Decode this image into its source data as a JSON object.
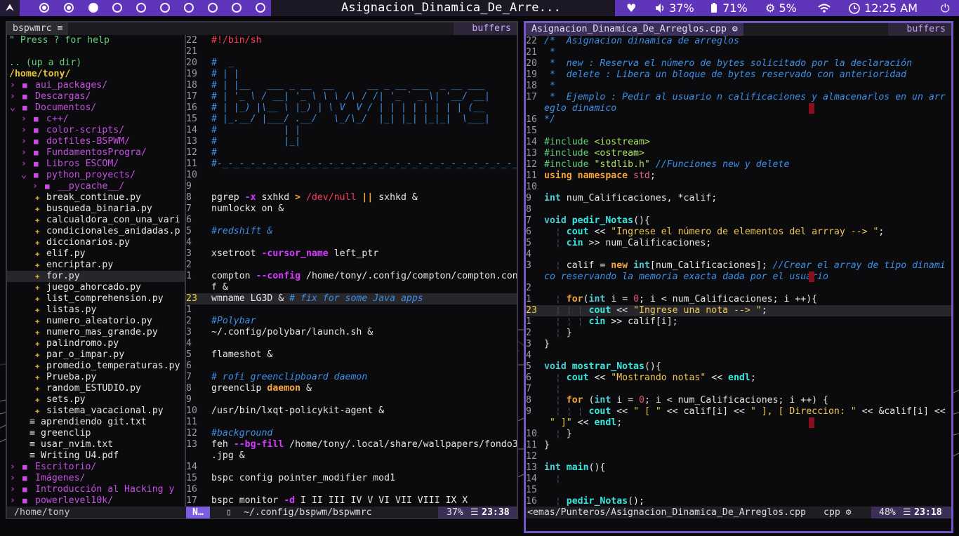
{
  "topbar": {
    "logo": "⮝",
    "window_title": "Asignacion_Dinamica_De_Arre...",
    "heart": "♥",
    "volume": "37%",
    "battery": "71%",
    "cpu": "5%",
    "clock": "12:25 AM",
    "power": "⏻"
  },
  "left": {
    "tab_title": "bspwmrc ≡",
    "buffers": "buffers",
    "status_path": "/home/tony",
    "status_mode": "N…",
    "status_file": "~/.config/bspwm/bspwmrc",
    "status_percent": "37%",
    "status_pos": "23:38"
  },
  "tree": [
    {
      "t": "\" Press ? for help",
      "c": "c-grn",
      "i": 0
    },
    {
      "t": "",
      "i": 0
    },
    {
      "t": ".. (up a dir)",
      "c": "c-grn",
      "i": 0
    },
    {
      "t": "/home/tony/",
      "c": "c-yel",
      "i": 0,
      "b": true
    },
    {
      "t": "aui_packages/",
      "k": "d",
      "o": false,
      "i": 0
    },
    {
      "t": "Descargas/",
      "k": "d",
      "o": false,
      "i": 0
    },
    {
      "t": "Documentos/",
      "k": "d",
      "o": true,
      "i": 0
    },
    {
      "t": "c++/",
      "k": "d",
      "o": false,
      "i": 1
    },
    {
      "t": "color-scripts/",
      "k": "d",
      "o": false,
      "i": 1
    },
    {
      "t": "dotfiles-BSPWM/",
      "k": "d",
      "o": false,
      "i": 1
    },
    {
      "t": "FundamentosProgra/",
      "k": "d",
      "o": false,
      "i": 1
    },
    {
      "t": "Libros ESCOM/",
      "k": "d",
      "o": false,
      "i": 1
    },
    {
      "t": "python_proyects/",
      "k": "d",
      "o": true,
      "i": 1
    },
    {
      "t": "__pycache__/",
      "k": "d",
      "o": false,
      "i": 2
    },
    {
      "t": "break_continue.py",
      "k": "p",
      "i": 2
    },
    {
      "t": "busqueda_binaria.py",
      "k": "p",
      "i": 2
    },
    {
      "t": "calcualdora_con_una_vari",
      "k": "p",
      "i": 2
    },
    {
      "t": "condicionales_anidadas.p",
      "k": "p",
      "i": 2
    },
    {
      "t": "diccionarios.py",
      "k": "p",
      "i": 2
    },
    {
      "t": "elif.py",
      "k": "p",
      "i": 2
    },
    {
      "t": "encriptar.py",
      "k": "p",
      "i": 2
    },
    {
      "t": "for.py",
      "k": "p",
      "i": 2,
      "sel": true
    },
    {
      "t": "juego_ahorcado.py",
      "k": "p",
      "i": 2
    },
    {
      "t": "list_comprehension.py",
      "k": "p",
      "i": 2
    },
    {
      "t": "listas.py",
      "k": "p",
      "i": 2
    },
    {
      "t": "numero_aleatorio.py",
      "k": "p",
      "i": 2
    },
    {
      "t": "numero_mas_grande.py",
      "k": "p",
      "i": 2
    },
    {
      "t": "palindromo.py",
      "k": "p",
      "i": 2
    },
    {
      "t": "par_o_impar.py",
      "k": "p",
      "i": 2
    },
    {
      "t": "promedio_temperaturas.py",
      "k": "p",
      "i": 2
    },
    {
      "t": "Prueba.py",
      "k": "p",
      "i": 2
    },
    {
      "t": "random_ESTUDIO.py",
      "k": "p",
      "i": 2
    },
    {
      "t": "sets.py",
      "k": "p",
      "i": 2
    },
    {
      "t": "sistema_vacacional.py",
      "k": "p",
      "i": 2
    },
    {
      "t": "aprendiendo git.txt",
      "k": "t",
      "i": 1
    },
    {
      "t": "greenclip",
      "k": "t",
      "i": 1
    },
    {
      "t": "usar_nvim.txt",
      "k": "t",
      "i": 1
    },
    {
      "t": "Writing U4.pdf",
      "k": "t",
      "i": 1
    },
    {
      "t": "Escritorio/",
      "k": "d",
      "o": false,
      "i": 0
    },
    {
      "t": "Imágenes/",
      "k": "d",
      "o": false,
      "i": 0
    },
    {
      "t": "Introducción al Hacking y",
      "k": "d",
      "o": false,
      "i": 0
    },
    {
      "t": "powerlevel10k/",
      "k": "d",
      "o": false,
      "i": 0
    }
  ],
  "bspwm_lines": [
    {
      "n": "22",
      "h": [
        [
          "c-red",
          "#!/bin/sh"
        ]
      ]
    },
    {
      "n": "21",
      "h": []
    },
    {
      "n": "20",
      "h": [
        [
          "c-cmt",
          "#  _"
        ]
      ]
    },
    {
      "n": "19",
      "h": [
        [
          "c-cmt",
          "# | |"
        ]
      ]
    },
    {
      "n": "18",
      "h": [
        [
          "c-cmt",
          "# | |__   ___ _ __  __      __ _ __ ___  _ __ ___"
        ]
      ]
    },
    {
      "n": "17",
      "h": [
        [
          "c-cmt",
          "# | '_ \\ / __| '_ \\ \\ \\ /\\ / /| '_ ` _ \\| '__/ __|"
        ]
      ]
    },
    {
      "n": "16",
      "h": [
        [
          "c-cmt",
          "# | |_) |\\__ \\ |_) | \\ V  V / | | | | | | | | (__"
        ]
      ]
    },
    {
      "n": "15",
      "h": [
        [
          "c-cmt",
          "# |_.__/ |___/ .__/   \\_/\\_/  |_| |_| |_|_|  \\___|"
        ]
      ]
    },
    {
      "n": "14",
      "h": [
        [
          "c-cmt",
          "#            | |"
        ]
      ]
    },
    {
      "n": "13",
      "h": [
        [
          "c-cmt",
          "#            |_|"
        ]
      ]
    },
    {
      "n": "12",
      "h": [
        [
          "c-cmt",
          "#"
        ]
      ]
    },
    {
      "n": "11",
      "h": [
        [
          "c-cmt",
          "#-_-_-_-_-_-_-_-_-_-_-_-_-_-_-_-_-_-_-_-_-_-_-_-_-_-_-_-_"
        ]
      ]
    },
    {
      "n": "10",
      "h": []
    },
    {
      "n": "9",
      "h": []
    },
    {
      "n": "8",
      "h": [
        [
          "",
          "pgrep "
        ],
        [
          "c-opt",
          "-x"
        ],
        [
          "",
          " sxhkd "
        ],
        [
          "c-kw",
          ">"
        ],
        [
          "c-red",
          " /dev/null "
        ],
        [
          "c-kw",
          "||"
        ],
        [
          "",
          " sxhkd &"
        ]
      ]
    },
    {
      "n": "7",
      "h": [
        [
          "",
          "numlockx on &"
        ]
      ]
    },
    {
      "n": "6",
      "h": []
    },
    {
      "n": "5",
      "h": [
        [
          "c-cmt",
          "#redshift &"
        ]
      ]
    },
    {
      "n": "4",
      "h": []
    },
    {
      "n": "3",
      "h": [
        [
          "",
          "xsetroot "
        ],
        [
          "c-opt",
          "-cursor_name"
        ],
        [
          "",
          " left_ptr"
        ]
      ]
    },
    {
      "n": "2",
      "h": []
    },
    {
      "n": "1",
      "h": [
        [
          "",
          "compton "
        ],
        [
          "c-opt",
          "--config"
        ],
        [
          "",
          " /home/tony/.config/compton/compton.con"
        ]
      ]
    },
    {
      "n": "",
      "h": [
        [
          "",
          "f &"
        ]
      ]
    },
    {
      "n": "23",
      "cur": true,
      "h": [
        [
          "",
          "wmname LG3D & "
        ],
        [
          "c-cmt",
          "# fix for some Java apps"
        ]
      ]
    },
    {
      "n": "1",
      "h": []
    },
    {
      "n": "2",
      "h": [
        [
          "c-cmt",
          "#Polybar"
        ]
      ]
    },
    {
      "n": "3",
      "h": [
        [
          "",
          "~/.config/polybar/launch.sh &"
        ]
      ]
    },
    {
      "n": "4",
      "h": []
    },
    {
      "n": "5",
      "h": [
        [
          "",
          "flameshot &"
        ]
      ]
    },
    {
      "n": "6",
      "h": []
    },
    {
      "n": "7",
      "h": [
        [
          "c-cmt",
          "# rofi greenclipboard daemon"
        ]
      ]
    },
    {
      "n": "8",
      "h": [
        [
          "",
          "greenclip "
        ],
        [
          "c-kw",
          "daemon"
        ],
        [
          "",
          " &"
        ]
      ]
    },
    {
      "n": "9",
      "h": []
    },
    {
      "n": "10",
      "h": [
        [
          "",
          "/usr/bin/lxqt-policykit-agent &"
        ]
      ]
    },
    {
      "n": "11",
      "h": []
    },
    {
      "n": "12",
      "h": [
        [
          "c-cmt",
          "#background"
        ]
      ]
    },
    {
      "n": "13",
      "h": [
        [
          "",
          "feh "
        ],
        [
          "c-opt",
          "--bg-fill"
        ],
        [
          "",
          " /home/tony/.local/share/wallpapers/fondo3"
        ]
      ]
    },
    {
      "n": "",
      "h": [
        [
          "",
          ".jpg &"
        ]
      ]
    },
    {
      "n": "14",
      "h": []
    },
    {
      "n": "15",
      "h": [
        [
          "",
          "bspc config pointer_modifier mod1"
        ]
      ]
    },
    {
      "n": "16",
      "h": []
    },
    {
      "n": "17",
      "h": [
        [
          "",
          "bspc monitor "
        ],
        [
          "c-opt",
          "-d"
        ],
        [
          "",
          " I II III IV V VI VII VIII IX X"
        ]
      ]
    }
  ],
  "right": {
    "tab_title": "Asignacion_Dinamica_De_Arreglos.cpp ⚙",
    "buffers": "buffers",
    "status_file": "<emas/Punteros/Asignacion_Dinamica_De_Arreglos.cpp",
    "status_ft": "cpp ⚙",
    "status_percent": "48%",
    "status_pos": "23:18"
  },
  "cpp_lines": [
    {
      "n": "22",
      "h": [
        [
          "c-cmt",
          "/*  Asignacion dinamica de arreglos"
        ]
      ]
    },
    {
      "n": "21",
      "h": [
        [
          "c-cmt",
          " *"
        ]
      ]
    },
    {
      "n": "20",
      "h": [
        [
          "c-cmt",
          " *  new : Reserva el número de bytes solicitado por la declaración"
        ]
      ]
    },
    {
      "n": "19",
      "h": [
        [
          "c-cmt",
          " *  delete : Libera un bloque de bytes reservado con anterioridad"
        ]
      ]
    },
    {
      "n": "18",
      "h": [
        [
          "c-cmt",
          " *"
        ]
      ]
    },
    {
      "n": "17",
      "h": [
        [
          "c-cmt",
          " *  Ejemplo : Pedir al usuario n calificaciones y almacenarlos en un arr"
        ]
      ]
    },
    {
      "n": "",
      "h": [
        [
          "c-cmt",
          "eglo dinamico"
        ]
      ]
    },
    {
      "n": "16",
      "h": [
        [
          "c-cmt",
          "*/"
        ]
      ]
    },
    {
      "n": "15",
      "h": []
    },
    {
      "n": "14",
      "h": [
        [
          "c-grn",
          "#include "
        ],
        [
          "c-inc",
          "<iostream>"
        ]
      ]
    },
    {
      "n": "13",
      "h": [
        [
          "c-grn",
          "#include "
        ],
        [
          "c-inc",
          "<ostream>"
        ]
      ]
    },
    {
      "n": "12",
      "h": [
        [
          "c-grn",
          "#include "
        ],
        [
          "c-inc",
          "\"stdlib.h\""
        ],
        [
          "",
          " "
        ],
        [
          "c-cmt",
          "//Funciones new y delete"
        ]
      ]
    },
    {
      "n": "11",
      "h": [
        [
          "c-kw",
          "using namespace"
        ],
        [
          "",
          " "
        ],
        [
          "c-std",
          "std"
        ],
        [
          "",
          ";"
        ]
      ]
    },
    {
      "n": "10",
      "h": []
    },
    {
      "n": "9",
      "h": [
        [
          "c-type",
          "int"
        ],
        [
          "",
          " num_Calificaciones, *calif;"
        ]
      ]
    },
    {
      "n": "8",
      "h": []
    },
    {
      "n": "7",
      "h": [
        [
          "c-type",
          "void"
        ],
        [
          "",
          " "
        ],
        [
          "c-fn",
          "pedir_Notas"
        ],
        [
          "",
          "(){"
        ]
      ]
    },
    {
      "n": "6",
      "h": [
        [
          "guide",
          "  ¦ "
        ],
        [
          "c-fn",
          "cout"
        ],
        [
          "",
          " << "
        ],
        [
          "c-str",
          "\"Ingrese el número de elementos del arrray --> \""
        ],
        [
          "",
          ";"
        ]
      ]
    },
    {
      "n": "5",
      "h": [
        [
          "guide",
          "  ¦ "
        ],
        [
          "c-fn",
          "cin"
        ],
        [
          "",
          " >> num_Calificaciones;"
        ]
      ]
    },
    {
      "n": "4",
      "h": []
    },
    {
      "n": "3",
      "h": [
        [
          "guide",
          "  ¦ "
        ],
        [
          "",
          "calif = "
        ],
        [
          "c-kw",
          "new"
        ],
        [
          "",
          " "
        ],
        [
          "c-type",
          "int"
        ],
        [
          "",
          "[num_Calificaciones]; "
        ],
        [
          "c-cmt",
          "//Crear el array de tipo dinami"
        ]
      ]
    },
    {
      "n": "",
      "h": [
        [
          "c-cmt",
          "co reservando la memoria exacta dada por el usuario"
        ]
      ]
    },
    {
      "n": "2",
      "h": []
    },
    {
      "n": "1",
      "h": [
        [
          "guide",
          "  ¦ "
        ],
        [
          "c-kw",
          "for"
        ],
        [
          "",
          "("
        ],
        [
          "c-type",
          "int"
        ],
        [
          "",
          " i = "
        ],
        [
          "c-num",
          "0"
        ],
        [
          "",
          "; i < num_Calificaciones; i ++){"
        ]
      ]
    },
    {
      "n": "23",
      "cur": true,
      "h": [
        [
          "guide",
          "  ¦ ¦ ¦ "
        ],
        [
          "c-fn",
          "cout"
        ],
        [
          "",
          " << "
        ],
        [
          "c-str",
          "\"Ingrese una nota --> \""
        ],
        [
          "",
          ";"
        ]
      ]
    },
    {
      "n": "1",
      "h": [
        [
          "guide",
          "  ¦ ¦ ¦ "
        ],
        [
          "c-fn",
          "cin"
        ],
        [
          "",
          " >> calif[i];"
        ]
      ]
    },
    {
      "n": "2",
      "h": [
        [
          "guide",
          "  ¦ "
        ],
        [
          "",
          "}"
        ]
      ]
    },
    {
      "n": "3",
      "h": [
        [
          "",
          "}"
        ]
      ]
    },
    {
      "n": "4",
      "h": []
    },
    {
      "n": "5",
      "h": [
        [
          "c-type",
          "void"
        ],
        [
          "",
          " "
        ],
        [
          "c-fn",
          "mostrar_Notas"
        ],
        [
          "",
          "(){"
        ]
      ]
    },
    {
      "n": "6",
      "h": [
        [
          "guide",
          "  ¦ "
        ],
        [
          "c-fn",
          "cout"
        ],
        [
          "",
          " << "
        ],
        [
          "c-str",
          "\"Mostrando notas\""
        ],
        [
          "",
          " << "
        ],
        [
          "c-fn",
          "endl"
        ],
        [
          "",
          ";"
        ]
      ]
    },
    {
      "n": "7",
      "h": [
        [
          "guide",
          "  ¦"
        ]
      ]
    },
    {
      "n": "8",
      "h": [
        [
          "guide",
          "  ¦ "
        ],
        [
          "c-kw",
          "for"
        ],
        [
          "",
          " ("
        ],
        [
          "c-type",
          "int"
        ],
        [
          "",
          " i = "
        ],
        [
          "c-num",
          "0"
        ],
        [
          "",
          "; i < num_Calificaciones; i ++) {"
        ]
      ]
    },
    {
      "n": "9",
      "h": [
        [
          "guide",
          "  ¦ ¦ ¦ "
        ],
        [
          "c-fn",
          "cout"
        ],
        [
          "",
          " << "
        ],
        [
          "c-str",
          "\" [ \""
        ],
        [
          "",
          " << calif[i] << "
        ],
        [
          "c-str",
          "\" ], [ Direccion: \""
        ],
        [
          "",
          " << &calif[i] <<"
        ]
      ]
    },
    {
      "n": "",
      "h": [
        [
          "c-str",
          " \" ]\""
        ],
        [
          "",
          " << "
        ],
        [
          "c-fn",
          "endl"
        ],
        [
          "",
          ";"
        ]
      ]
    },
    {
      "n": "10",
      "h": [
        [
          "guide",
          "  ¦ "
        ],
        [
          "",
          "}"
        ]
      ]
    },
    {
      "n": "11",
      "h": [
        [
          "",
          "}"
        ]
      ]
    },
    {
      "n": "12",
      "h": []
    },
    {
      "n": "13",
      "h": [
        [
          "c-type",
          "int"
        ],
        [
          "",
          " "
        ],
        [
          "c-fn",
          "main"
        ],
        [
          "",
          "(){"
        ]
      ]
    },
    {
      "n": "14",
      "h": [
        [
          "guide",
          "  ¦"
        ]
      ]
    },
    {
      "n": "15",
      "h": []
    },
    {
      "n": "16",
      "h": [
        [
          "guide",
          "  ¦ "
        ],
        [
          "c-fn",
          "pedir_Notas"
        ],
        [
          "",
          "();"
        ]
      ]
    }
  ]
}
